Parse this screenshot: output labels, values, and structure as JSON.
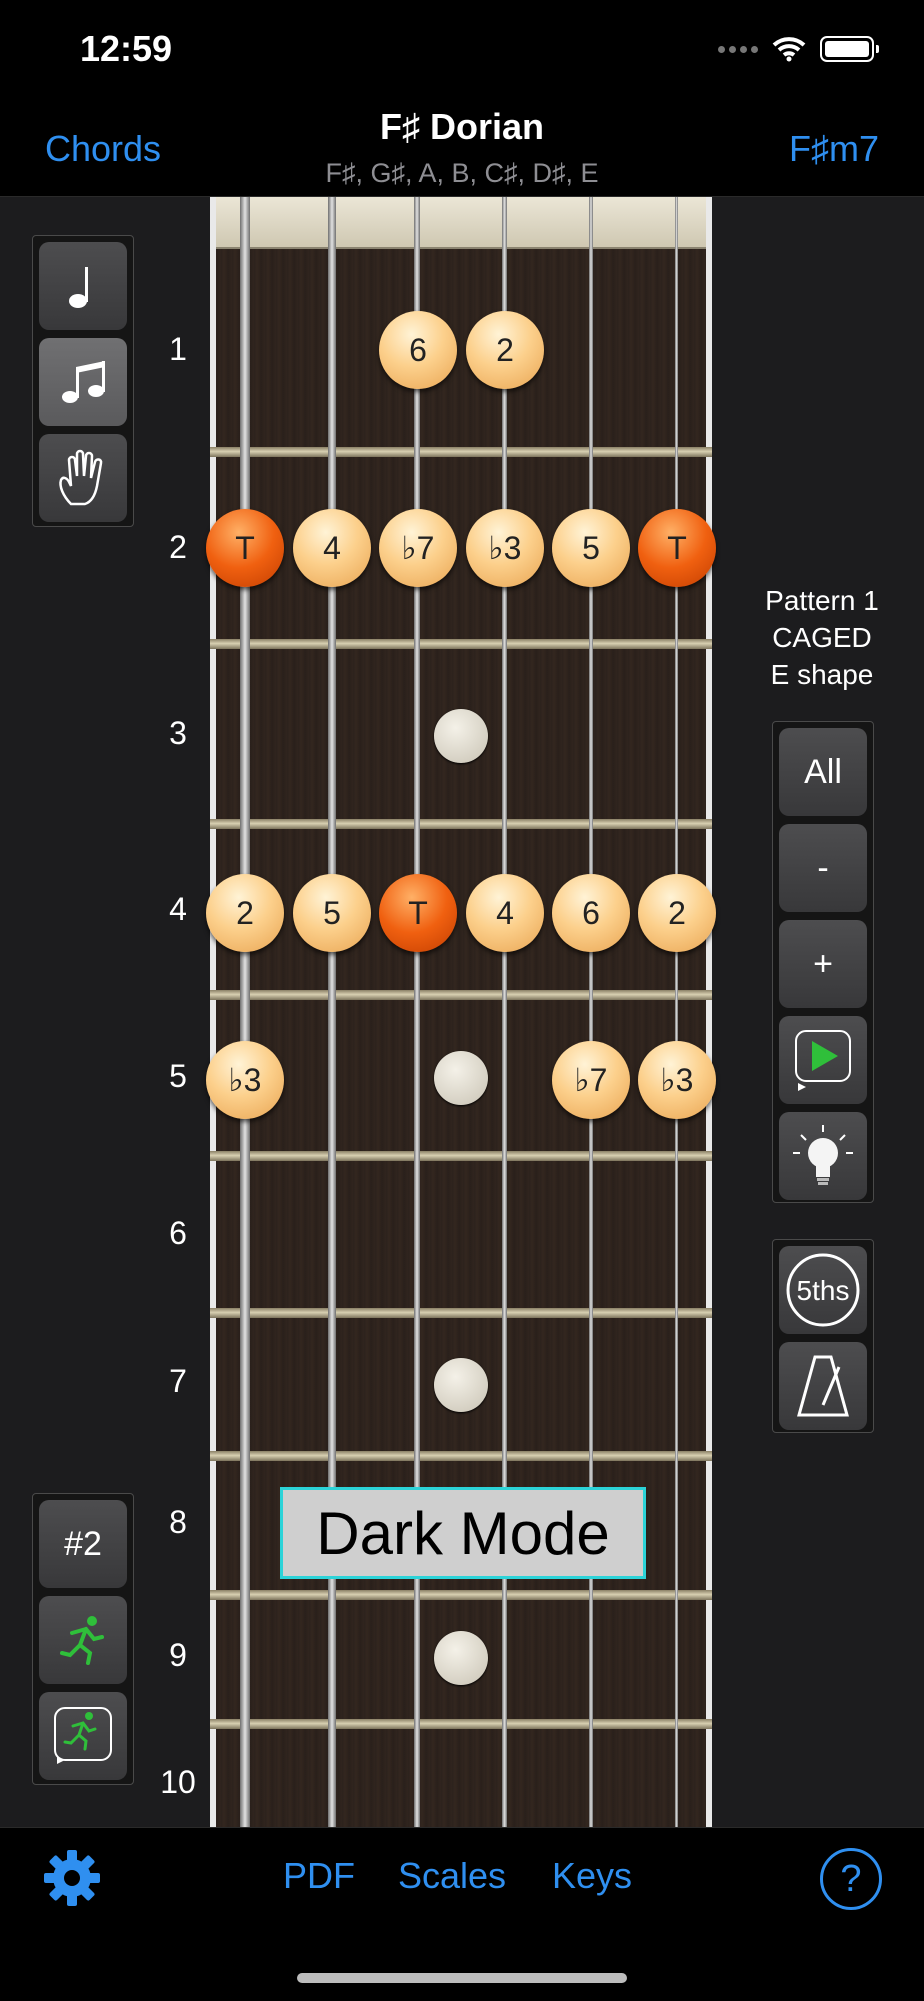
{
  "status_bar": {
    "time": "12:59"
  },
  "nav": {
    "left": "Chords",
    "title": "F♯ Dorian",
    "subtitle": "F♯, G♯, A, B, C♯, D♯, E",
    "right": "F♯m7"
  },
  "left_panel_top": {
    "icons": [
      "quarter-note-icon",
      "eighth-notes-icon",
      "hand-icon"
    ],
    "selected": 1
  },
  "left_panel_bottom": {
    "position_label": "#2",
    "icons": [
      "runner-icon",
      "runner-loop-icon"
    ]
  },
  "fret_numbers": [
    "1",
    "2",
    "3",
    "4",
    "5",
    "6",
    "7",
    "8",
    "9",
    "10"
  ],
  "notes": [
    {
      "fret": 1,
      "string": 3,
      "label": "6",
      "root": false
    },
    {
      "fret": 1,
      "string": 4,
      "label": "2",
      "root": false
    },
    {
      "fret": 2,
      "string": 1,
      "label": "T",
      "root": true
    },
    {
      "fret": 2,
      "string": 2,
      "label": "4",
      "root": false
    },
    {
      "fret": 2,
      "string": 3,
      "label": "♭7",
      "root": false
    },
    {
      "fret": 2,
      "string": 4,
      "label": "♭3",
      "root": false
    },
    {
      "fret": 2,
      "string": 5,
      "label": "5",
      "root": false
    },
    {
      "fret": 2,
      "string": 6,
      "label": "T",
      "root": true
    },
    {
      "fret": 4,
      "string": 1,
      "label": "2",
      "root": false
    },
    {
      "fret": 4,
      "string": 2,
      "label": "5",
      "root": false
    },
    {
      "fret": 4,
      "string": 3,
      "label": "T",
      "root": true
    },
    {
      "fret": 4,
      "string": 4,
      "label": "4",
      "root": false
    },
    {
      "fret": 4,
      "string": 5,
      "label": "6",
      "root": false
    },
    {
      "fret": 4,
      "string": 6,
      "label": "2",
      "root": false
    },
    {
      "fret": 5,
      "string": 1,
      "label": "♭3",
      "root": false
    },
    {
      "fret": 5,
      "string": 5,
      "label": "♭7",
      "root": false
    },
    {
      "fret": 5,
      "string": 6,
      "label": "♭3",
      "root": false
    }
  ],
  "pattern": {
    "line1": "Pattern 1",
    "line2": "CAGED",
    "line3": "E shape"
  },
  "right_panel": {
    "all_label": "All",
    "minus_label": "-",
    "plus_label": "+",
    "icons": [
      "play-loop-icon",
      "lightbulb-icon"
    ]
  },
  "right_panel_bottom": {
    "fifths_label": "5ths",
    "icons": [
      "fifths-icon",
      "metronome-icon"
    ]
  },
  "overlay": {
    "label": "Dark Mode"
  },
  "bottom_bar": {
    "pdf": "PDF",
    "scales": "Scales",
    "keys": "Keys",
    "help": "?",
    "icons": [
      "gear-icon",
      "help-icon"
    ]
  },
  "colors": {
    "accent": "#2f8ff0",
    "root": "#f06010",
    "scale_note": "#fcd08c",
    "overlay_border": "#2cd3d8"
  }
}
